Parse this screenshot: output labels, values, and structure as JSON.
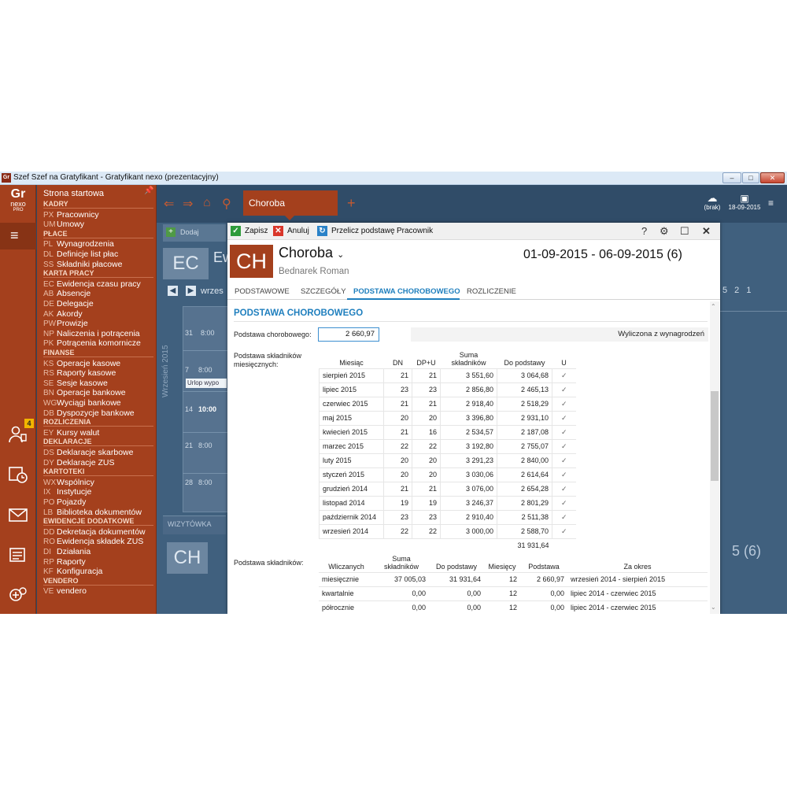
{
  "window": {
    "icon": "Gr",
    "title": "Szef Szef na Gratyfikant - Gratyfikant nexo (prezentacyjny)",
    "controls": [
      "minimize-icon",
      "maximize-icon",
      "close-icon"
    ]
  },
  "logo": {
    "line1": "Gr",
    "line2": "nexo",
    "line3": "PRO"
  },
  "badge_count": "4",
  "menu": {
    "home": "Strona startowa",
    "sections": [
      {
        "title": "KADRY",
        "items": [
          {
            "code": "PX",
            "label": "Pracownicy"
          },
          {
            "code": "UM",
            "label": "Umowy"
          }
        ]
      },
      {
        "title": "PŁACE",
        "items": [
          {
            "code": "PL",
            "label": "Wynagrodzenia"
          },
          {
            "code": "DL",
            "label": "Definicje list płac"
          },
          {
            "code": "SS",
            "label": "Składniki płacowe"
          }
        ]
      },
      {
        "title": "KARTA PRACY",
        "items": [
          {
            "code": "EC",
            "label": "Ewidencja czasu pracy"
          },
          {
            "code": "AB",
            "label": "Absencje"
          },
          {
            "code": "DE",
            "label": "Delegacje"
          },
          {
            "code": "AK",
            "label": "Akordy"
          },
          {
            "code": "PW",
            "label": "Prowizje"
          },
          {
            "code": "NP",
            "label": "Naliczenia i potrącenia"
          },
          {
            "code": "PK",
            "label": "Potrącenia komornicze"
          }
        ]
      },
      {
        "title": "FINANSE",
        "items": [
          {
            "code": "KS",
            "label": "Operacje kasowe"
          },
          {
            "code": "RS",
            "label": "Raporty kasowe"
          },
          {
            "code": "SE",
            "label": "Sesje kasowe"
          },
          {
            "code": "BN",
            "label": "Operacje bankowe"
          },
          {
            "code": "WG",
            "label": "Wyciągi bankowe"
          },
          {
            "code": "DB",
            "label": "Dyspozycje bankowe"
          }
        ]
      },
      {
        "title": "ROZLICZENIA",
        "items": [
          {
            "code": "EY",
            "label": "Kursy walut"
          }
        ]
      },
      {
        "title": "DEKLARACJE",
        "items": [
          {
            "code": "DS",
            "label": "Deklaracje skarbowe"
          },
          {
            "code": "DY",
            "label": "Deklaracje ZUS"
          }
        ]
      },
      {
        "title": "KARTOTEKI",
        "items": [
          {
            "code": "WX",
            "label": "Wspólnicy"
          },
          {
            "code": "IX",
            "label": "Instytucje"
          },
          {
            "code": "PO",
            "label": "Pojazdy"
          },
          {
            "code": "LB",
            "label": "Biblioteka dokumentów"
          }
        ]
      },
      {
        "title": "EWIDENCJE DODATKOWE",
        "items": [
          {
            "code": "DD",
            "label": "Dekretacja dokumentów"
          },
          {
            "code": "RO",
            "label": "Ewidencja składek ZUS"
          },
          {
            "code": "DI",
            "label": "Działania"
          },
          {
            "code": "RP",
            "label": "Raporty"
          },
          {
            "code": "KF",
            "label": "Konfiguracja"
          }
        ]
      },
      {
        "title": "VENDERO",
        "items": [
          {
            "code": "VE",
            "label": "vendero"
          }
        ]
      }
    ]
  },
  "topbar": {
    "active_tab": "Choroba",
    "user_label": "(brak)",
    "date_label": "18-09-2015"
  },
  "background": {
    "toolbar_add": "Dodaj",
    "tile": "EC",
    "tile_prefix": "Ew",
    "month_label": "wrzes",
    "vertical_label": "Wrzesień 2015",
    "day_nums": [
      "31",
      "7",
      "14",
      "21",
      "28"
    ],
    "times": [
      "8:00",
      "8:00",
      "10:00",
      "8:00",
      "8:00"
    ],
    "event": "Urlop wypo",
    "wiz_label": "WIZYTÓWKA",
    "bottom_tile": "CH",
    "right_nums": "5 2 1",
    "right_big": "5 (6)"
  },
  "dialog": {
    "toolbar": {
      "save": "Zapisz",
      "cancel": "Anuluj",
      "recalc": "Przelicz podstawę",
      "worker": "Pracownik",
      "help_icon": "?"
    },
    "avatar": "CH",
    "title": "Choroba",
    "employee": "Bednarek Roman",
    "date_range": "01-09-2015 - 06-09-2015 (6)",
    "tabs": [
      "PODSTAWOWE",
      "SZCZEGÓŁY",
      "PODSTAWA CHOROBOWEGO",
      "ROZLICZENIE"
    ],
    "section_title": "PODSTAWA CHOROBOWEGO",
    "base_label": "Podstawa chorobowego:",
    "base_value": "2 660,97",
    "base_source": "Wyliczona z wynagrodzeń",
    "monthly_label": "Podstawa składników miesięcznych:",
    "monthly_headers": [
      "Miesiąc",
      "DN",
      "DP+U",
      "Suma składników",
      "Do podstawy",
      "U"
    ],
    "monthly_rows": [
      [
        "sierpień 2015",
        "21",
        "21",
        "3 551,60",
        "3 064,68"
      ],
      [
        "lipiec 2015",
        "23",
        "23",
        "2 856,80",
        "2 465,13"
      ],
      [
        "czerwiec 2015",
        "21",
        "21",
        "2 918,40",
        "2 518,29"
      ],
      [
        "maj 2015",
        "20",
        "20",
        "3 396,80",
        "2 931,10"
      ],
      [
        "kwiecień 2015",
        "21",
        "16",
        "2 534,57",
        "2 187,08"
      ],
      [
        "marzec 2015",
        "22",
        "22",
        "3 192,80",
        "2 755,07"
      ],
      [
        "luty 2015",
        "20",
        "20",
        "3 291,23",
        "2 840,00"
      ],
      [
        "styczeń 2015",
        "20",
        "20",
        "3 030,06",
        "2 614,64"
      ],
      [
        "grudzień 2014",
        "21",
        "21",
        "3 076,00",
        "2 654,28"
      ],
      [
        "listopad 2014",
        "19",
        "19",
        "3 246,37",
        "2 801,29"
      ],
      [
        "październik 2014",
        "23",
        "23",
        "2 910,40",
        "2 511,38"
      ],
      [
        "wrzesień 2014",
        "22",
        "22",
        "3 000,00",
        "2 588,70"
      ]
    ],
    "monthly_total": "31 931,64",
    "components_label": "Podstawa składników:",
    "components_headers": [
      "Wliczanych",
      "Suma składników",
      "Do podstawy",
      "Miesięcy",
      "Podstawa",
      "Za okres"
    ],
    "components_rows": [
      [
        "miesięcznie",
        "37 005,03",
        "31 931,64",
        "12",
        "2 660,97",
        "wrzesień 2014 - sierpień 2015"
      ],
      [
        "kwartalnie",
        "0,00",
        "0,00",
        "12",
        "0,00",
        "lipiec 2014 - czerwiec 2015"
      ],
      [
        "półrocznie",
        "0,00",
        "0,00",
        "12",
        "0,00",
        "lipiec 2014 - czerwiec 2015"
      ]
    ]
  },
  "colors": {
    "brand": "#a4401d",
    "accent": "#1f7fbe",
    "background_panel": "#2e4a66"
  }
}
